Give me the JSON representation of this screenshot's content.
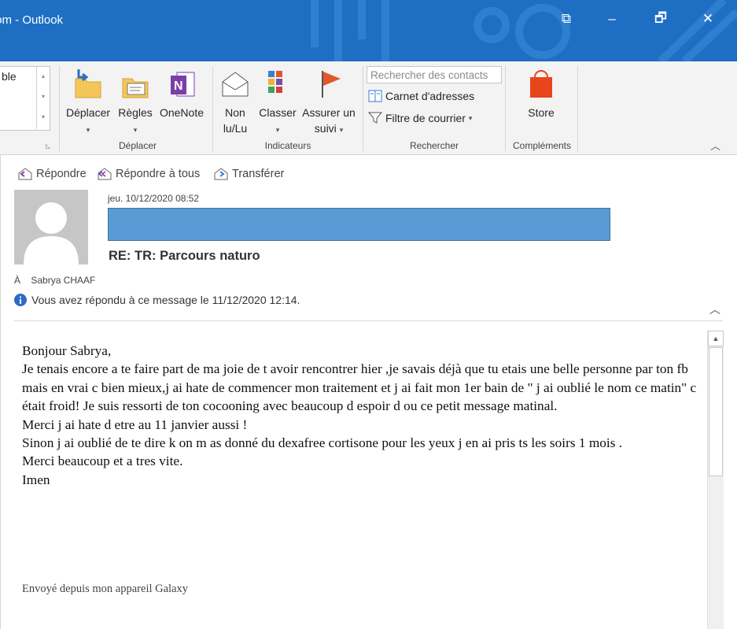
{
  "window": {
    "title": "mail.com - Outlook",
    "restore_glyph": "⧉",
    "minimize_glyph": "–",
    "maximize_glyph": "🗗",
    "close_glyph": "✕"
  },
  "ribbon": {
    "style_box_text": "ble",
    "groups": {
      "move": "Déplacer",
      "tags": "Indicateurs",
      "find": "Rechercher",
      "addins": "Compléments"
    },
    "buttons": {
      "move_line1": "Déplacer",
      "rules_line1": "Règles",
      "onenote": "OneNote",
      "unread_line1": "Non",
      "unread_line2": "lu/Lu",
      "categorize_line1": "Classer",
      "followup_line1": "Assurer un",
      "followup_line2": "suivi",
      "address_book": "Carnet d'adresses",
      "filter_email": "Filtre de courrier",
      "store": "Store"
    },
    "search_placeholder": "Rechercher des contacts"
  },
  "message": {
    "actions": {
      "reply": "Répondre",
      "reply_all": "Répondre à tous",
      "forward": "Transférer"
    },
    "date": "jeu. 10/12/2020 08:52",
    "subject": "RE: TR: Parcours naturo",
    "to_label": "À",
    "to_name": "Sabrya CHAAF",
    "info": "Vous avez répondu à ce message le 11/12/2020 12:14.",
    "body": [
      "Bonjour Sabrya,",
      "Je tenais encore a te faire part de ma joie de t avoir rencontrer hier ,je savais déjà que tu etais une belle personne par ton fb mais en vrai c bien mieux,j ai hate de commencer mon traitement et j ai fait mon 1er bain de \" j ai oublié le nom ce matin\" c était froid! Je suis ressorti de ton cocooning avec beaucoup d espoir d ou ce petit message matinal.",
      "Merci j ai hate d etre au 11 janvier aussi !",
      "Sinon j ai oublié de te dire k on m as donné du dexafree cortisone pour les yeux j en ai pris ts les soirs 1 mois .",
      "Merci beaucoup et a tres vite.",
      "Imen"
    ],
    "signature": "Envoyé depuis mon appareil Galaxy"
  },
  "colors": {
    "titlebar": "#1e6fc3",
    "redacted_block": "#5b9bd5",
    "info_icon": "#2b6cc4",
    "store_icon": "#e8451c"
  }
}
